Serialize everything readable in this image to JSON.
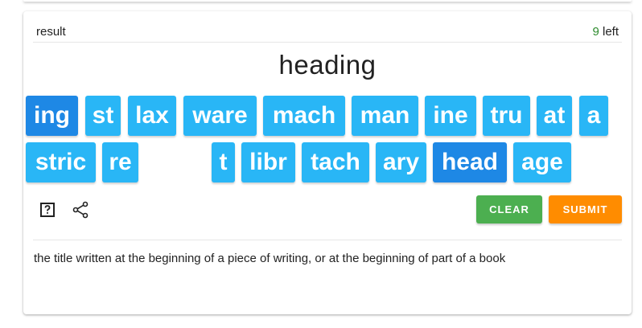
{
  "header": {
    "result_label": "result",
    "left_count": "9",
    "left_suffix": " left"
  },
  "answer": "heading",
  "tiles": [
    {
      "text": "ing",
      "selected": true
    },
    {
      "text": "st",
      "selected": false
    },
    {
      "text": "lax",
      "selected": false
    },
    {
      "text": "ware",
      "selected": false
    },
    {
      "text": "mach",
      "selected": false
    },
    {
      "text": "man",
      "selected": false
    },
    {
      "text": "ine",
      "selected": false
    },
    {
      "text": "tru",
      "selected": false
    },
    {
      "text": "at",
      "selected": false
    },
    {
      "text": "a",
      "selected": false
    },
    {
      "text": "stric",
      "selected": false
    },
    {
      "text": "re",
      "selected": false
    },
    {
      "text": "t",
      "selected": false
    },
    {
      "text": "libr",
      "selected": false
    },
    {
      "text": "tach",
      "selected": false
    },
    {
      "text": "ary",
      "selected": false
    },
    {
      "text": "head",
      "selected": true
    },
    {
      "text": "age",
      "selected": false
    }
  ],
  "toolbar": {
    "help_icon": "help-box-icon",
    "share_icon": "share-icon",
    "clear_label": "CLEAR",
    "submit_label": "SUBMIT"
  },
  "definition": "the title written at the beginning of a piece of writing, or at the beginning of part of a book",
  "colors": {
    "tile": "#29b6f6",
    "tile_selected": "#1e88e5",
    "clear": "#4caf50",
    "submit": "#ff8c00",
    "count": "#2e8b2e"
  }
}
